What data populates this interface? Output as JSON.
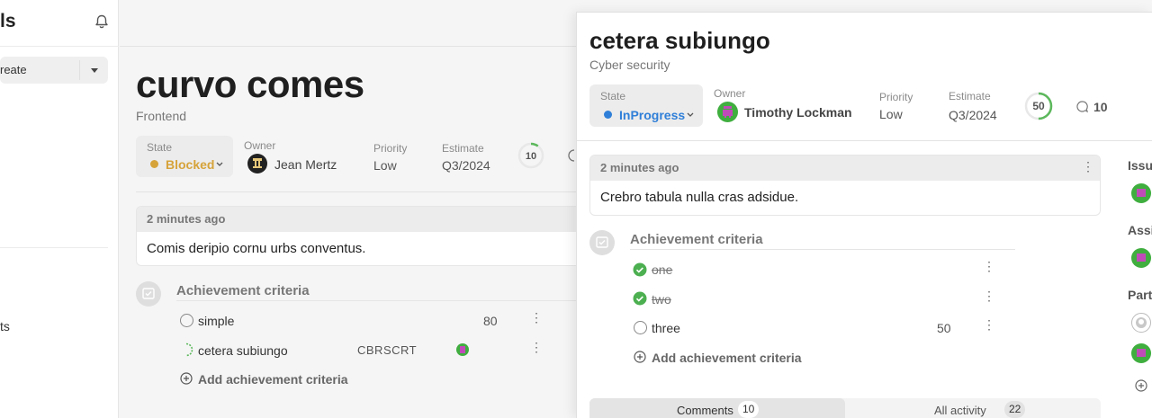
{
  "sidebar": {
    "title": "ls",
    "create_label": "reate",
    "item_label": "ts"
  },
  "main": {
    "title": "curvo comes",
    "subtitle": "Frontend",
    "state_label": "State",
    "state_value": "Blocked",
    "owner_label": "Owner",
    "owner_name": "Jean Mertz",
    "priority_label": "Priority",
    "priority_value": "Low",
    "estimate_label": "Estimate",
    "estimate_value": "Q3/2024",
    "progress_value": "10",
    "comment": {
      "time": "2 minutes ago",
      "body": "Comis deripio cornu urbs conventus."
    },
    "criteria_title": "Achievement criteria",
    "criteria": [
      {
        "label": "simple",
        "number": "80",
        "code": ""
      },
      {
        "label": "cetera subiungo",
        "number": "",
        "code": "CBRSCRT"
      }
    ],
    "add_criteria_label": "Add achievement criteria"
  },
  "panel": {
    "title": "cetera subiungo",
    "subtitle": "Cyber security",
    "state_label": "State",
    "state_value": "InProgress",
    "owner_label": "Owner",
    "owner_name": "Timothy Lockman",
    "priority_label": "Priority",
    "priority_value": "Low",
    "estimate_label": "Estimate",
    "estimate_value": "Q3/2024",
    "progress_value": "50",
    "comment_count": "10",
    "comment": {
      "time": "2 minutes ago",
      "body": "Crebro tabula nulla cras adsidue."
    },
    "criteria_title": "Achievement criteria",
    "criteria": [
      {
        "label": "one",
        "done": true,
        "number": ""
      },
      {
        "label": "two",
        "done": true,
        "number": ""
      },
      {
        "label": "three",
        "done": false,
        "number": "50"
      }
    ],
    "add_criteria_label": "Add achievement criteria",
    "tabs": [
      {
        "label": "Comments",
        "count": "10",
        "active": true
      },
      {
        "label": "All activity",
        "count": "22",
        "active": false
      }
    ],
    "right_labels": [
      "Issu",
      "Assi",
      "Part"
    ]
  },
  "colors": {
    "blocked": "#d6a33a",
    "inprogress": "#2f7fd8",
    "done_green": "#4caf50",
    "progress_green": "#5cb85c"
  }
}
